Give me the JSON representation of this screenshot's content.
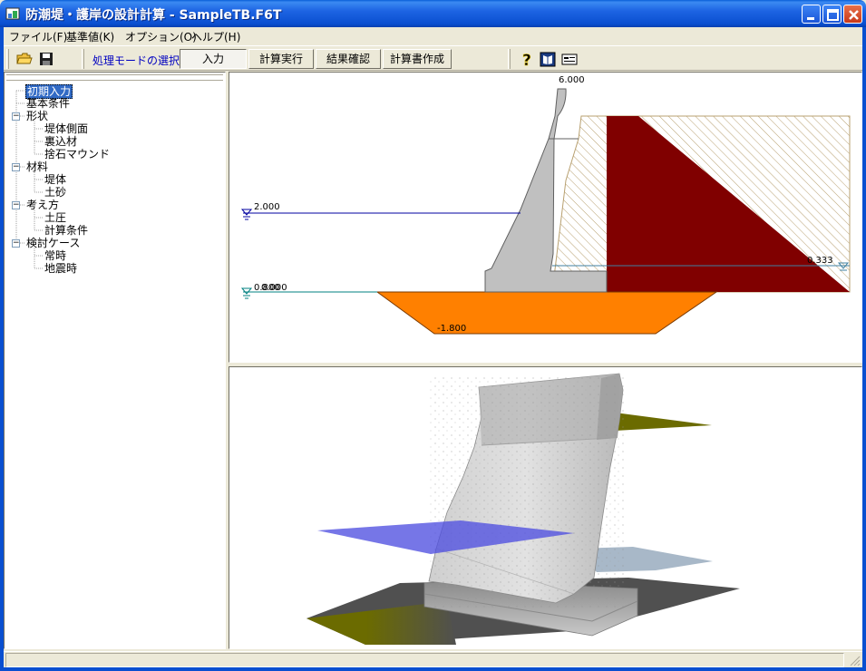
{
  "window": {
    "title": "防潮堤・護岸の設計計算 - SampleTB.F6T",
    "icon": "app-icon"
  },
  "menu": {
    "items": [
      {
        "label": "ファイル(F)"
      },
      {
        "label": "基準値(K)"
      },
      {
        "label": "オプション(O)"
      },
      {
        "label": "ヘルプ(H)"
      }
    ]
  },
  "toolbar": {
    "mode_label": "処理モードの選択",
    "buttons": [
      {
        "label": "入力",
        "active": true
      },
      {
        "label": "計算実行"
      },
      {
        "label": "結果確認"
      },
      {
        "label": "計算書作成"
      }
    ],
    "icons": [
      "open-folder-icon",
      "save-disk-icon",
      "help-icon",
      "manual-book-icon",
      "info-card-icon"
    ]
  },
  "tree": {
    "nodes": [
      {
        "label": "初期入力",
        "level": 0,
        "selected": true
      },
      {
        "label": "基本条件",
        "level": 0
      },
      {
        "label": "形状",
        "level": 0,
        "expander": "−"
      },
      {
        "label": "堤体側面",
        "level": 1
      },
      {
        "label": "裏込材",
        "level": 1
      },
      {
        "label": "捨石マウンド",
        "level": 1
      },
      {
        "label": "材料",
        "level": 0,
        "expander": "−"
      },
      {
        "label": "堤体",
        "level": 1
      },
      {
        "label": "土砂",
        "level": 1
      },
      {
        "label": "考え方",
        "level": 0,
        "expander": "−"
      },
      {
        "label": "土圧",
        "level": 1
      },
      {
        "label": "計算条件",
        "level": 1
      },
      {
        "label": "検討ケース",
        "level": 0,
        "expander": "−"
      },
      {
        "label": "常時",
        "level": 1
      },
      {
        "label": "地震時",
        "level": 1
      }
    ]
  },
  "section_view": {
    "labels": {
      "crest": "6.000",
      "water_level": "2.000",
      "ground_level": "0.000",
      "ground_level_overlap": "0.800",
      "mound_bottom": "-1.800",
      "rear_water": "0.333"
    },
    "colors": {
      "concrete": "#c0c0c0",
      "backfill_hatch": "#b8a070",
      "soil": "#800000",
      "mound": "#ff8000",
      "water_line": "#0000a0",
      "ground_line": "#008080"
    }
  },
  "view3d": {
    "colors": {
      "water_plane": "#5050e0",
      "upper_plane": "#6b6b00",
      "ground_plane": "#505050",
      "rear_plane": "#a8b8c8"
    }
  }
}
